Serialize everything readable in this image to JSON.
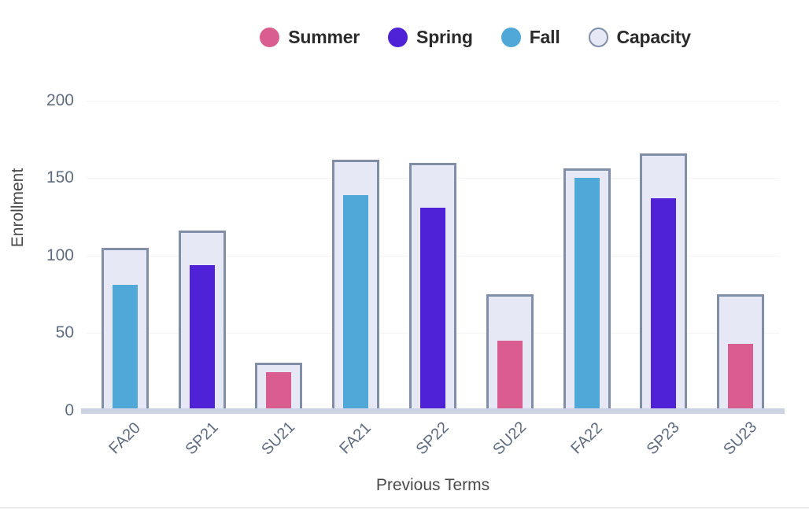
{
  "chart_data": {
    "type": "bar",
    "title": "",
    "xlabel": "Previous Terms",
    "ylabel": "Enrollment",
    "categories": [
      "FA20",
      "SP21",
      "SU21",
      "FA21",
      "SP22",
      "SU22",
      "FA22",
      "SP23",
      "SU23"
    ],
    "ylim": [
      0,
      210
    ],
    "yticks": [
      0,
      50,
      100,
      150,
      200
    ],
    "ytick_labels": [
      "0",
      "50",
      "100",
      "150",
      "200"
    ],
    "grid": true,
    "legend_position": "top-center",
    "series": [
      {
        "name": "Capacity",
        "color": "#e6e8f5",
        "border_color": "#808ea8",
        "values": [
          105,
          116,
          31,
          162,
          160,
          75,
          156,
          166,
          75
        ]
      },
      {
        "name": "Enrollment",
        "values": [
          81,
          94,
          25,
          139,
          131,
          45,
          150,
          137,
          43
        ],
        "term_types": [
          "Fall",
          "Spring",
          "Summer",
          "Fall",
          "Spring",
          "Summer",
          "Fall",
          "Spring",
          "Summer"
        ],
        "colors": [
          "#4fa8d8",
          "#4f22d8",
          "#d95d8f",
          "#4fa8d8",
          "#4f22d8",
          "#d95d8f",
          "#4fa8d8",
          "#4f22d8",
          "#d95d8f"
        ]
      }
    ],
    "legend": [
      {
        "label": "Summer",
        "color": "#d95d8f",
        "border_color": "#d95d8f"
      },
      {
        "label": "Spring",
        "color": "#4f22d8",
        "border_color": "#4f22d8"
      },
      {
        "label": "Fall",
        "color": "#4fa8d8",
        "border_color": "#4fa8d8"
      },
      {
        "label": "Capacity",
        "color": "#e6e8f5",
        "border_color": "#808ea8"
      }
    ]
  }
}
